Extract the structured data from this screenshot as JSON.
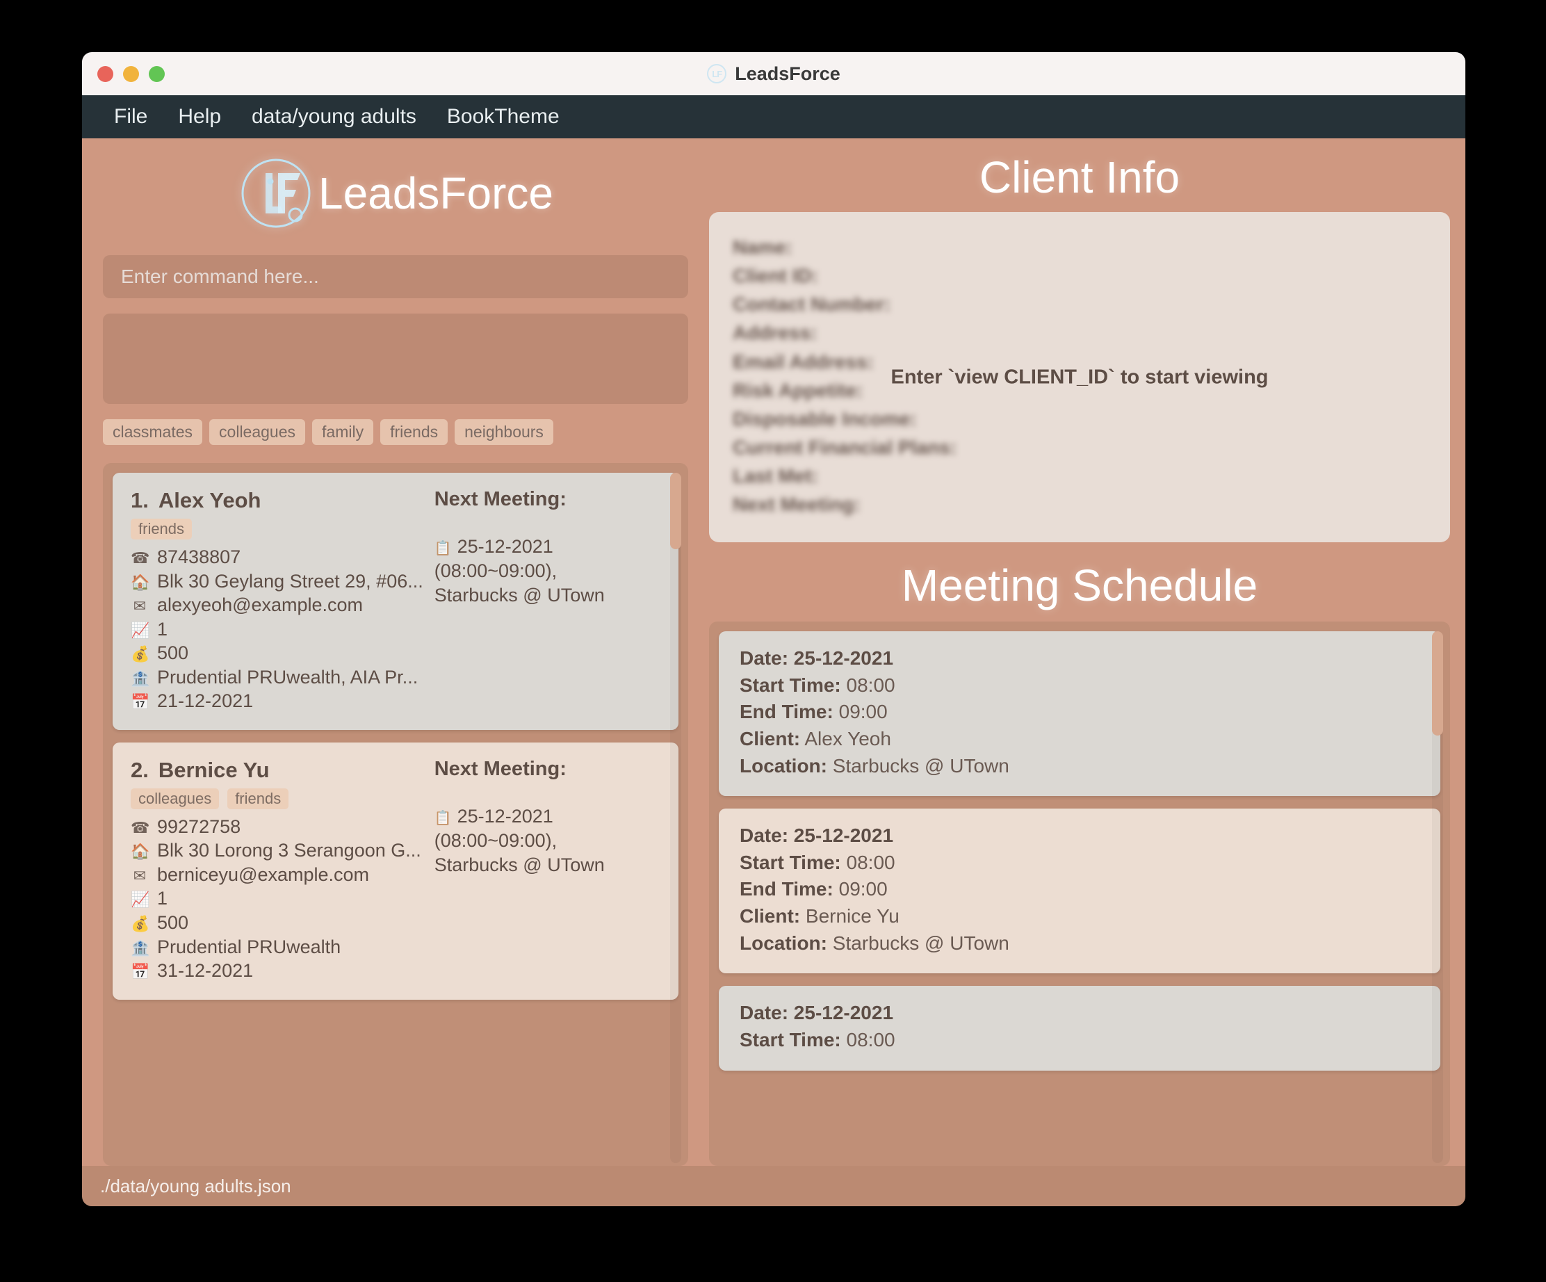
{
  "window": {
    "title": "LeadsForce",
    "logo_icon": "leadsforce-circle-lf-logo"
  },
  "menubar": {
    "items": [
      {
        "label": "File",
        "name": "menu-file"
      },
      {
        "label": "Help",
        "name": "menu-help"
      },
      {
        "label": "data/young adults",
        "name": "menu-data-young-adults"
      },
      {
        "label": "BookTheme",
        "name": "menu-booktheme"
      }
    ]
  },
  "brand": {
    "wordmark": "LeadsForce",
    "mark_letters": "LF"
  },
  "command": {
    "placeholder": "Enter command here...",
    "value": ""
  },
  "result_box": {
    "text": ""
  },
  "tags": [
    "classmates",
    "colleagues",
    "family",
    "friends",
    "neighbours"
  ],
  "clients": [
    {
      "index": "1.",
      "name": "Alex Yeoh",
      "tags": [
        "friends"
      ],
      "phone": "87438807",
      "address": "Blk 30 Geylang Street 29, #06...",
      "email": "alexyeoh@example.com",
      "risk_appetite": "1",
      "disposable_income": "500",
      "financial_plans": "Prudential PRUwealth, AIA Pr...",
      "last_met": "21-12-2021",
      "next_meeting_heading": "Next Meeting:",
      "next_meeting_line1": "25-12-2021 (08:00~09:00),",
      "next_meeting_line2": "Starbucks @ UTown"
    },
    {
      "index": "2.",
      "name": "Bernice Yu",
      "tags": [
        "colleagues",
        "friends"
      ],
      "phone": "99272758",
      "address": "Blk 30 Lorong 3 Serangoon G...",
      "email": "berniceyu@example.com",
      "risk_appetite": "1",
      "disposable_income": "500",
      "financial_plans": "Prudential PRUwealth",
      "last_met": "31-12-2021",
      "next_meeting_heading": "Next Meeting:",
      "next_meeting_line1": "25-12-2021 (08:00~09:00),",
      "next_meeting_line2": "Starbucks @ UTown"
    }
  ],
  "client_info": {
    "title": "Client Info",
    "labels": [
      "Name:",
      "Client ID:",
      "Contact Number:",
      "Address:",
      "Email Address:",
      "Risk Appetite:",
      "Disposable Income:",
      "Current Financial Plans:",
      "Last Met:",
      "Next Meeting:"
    ],
    "overlay_message": "Enter `view CLIENT_ID` to start viewing"
  },
  "meeting_schedule": {
    "title": "Meeting Schedule",
    "field_labels": {
      "date": "Date:",
      "start": "Start Time:",
      "end": "End Time:",
      "client": "Client:",
      "location": "Location:"
    },
    "meetings": [
      {
        "date": "25-12-2021",
        "start_time": "08:00",
        "end_time": "09:00",
        "client": "Alex Yeoh",
        "location": "Starbucks @ UTown"
      },
      {
        "date": "25-12-2021",
        "start_time": "08:00",
        "end_time": "09:00",
        "client": "Bernice Yu",
        "location": "Starbucks @ UTown"
      },
      {
        "date": "25-12-2021",
        "start_time": "08:00",
        "end_time": "",
        "client": "",
        "location": ""
      }
    ]
  },
  "statusbar": {
    "file_path": "./data/young adults.json"
  },
  "icons": {
    "phone": "☎",
    "home": "🏠",
    "email": "✉",
    "risk": "📈",
    "money": "💰",
    "bank": "🏦",
    "calendar": "📅",
    "meeting": "📋"
  },
  "colors": {
    "background": "#cf9881",
    "menubar": "#263238",
    "titlebar": "#f7f3f2",
    "card": "#dbd8d3",
    "card_alt": "#ecddd2",
    "panel": "#c08f77",
    "accent_text": "#5d4d45",
    "logo": "#cfe6f2"
  }
}
